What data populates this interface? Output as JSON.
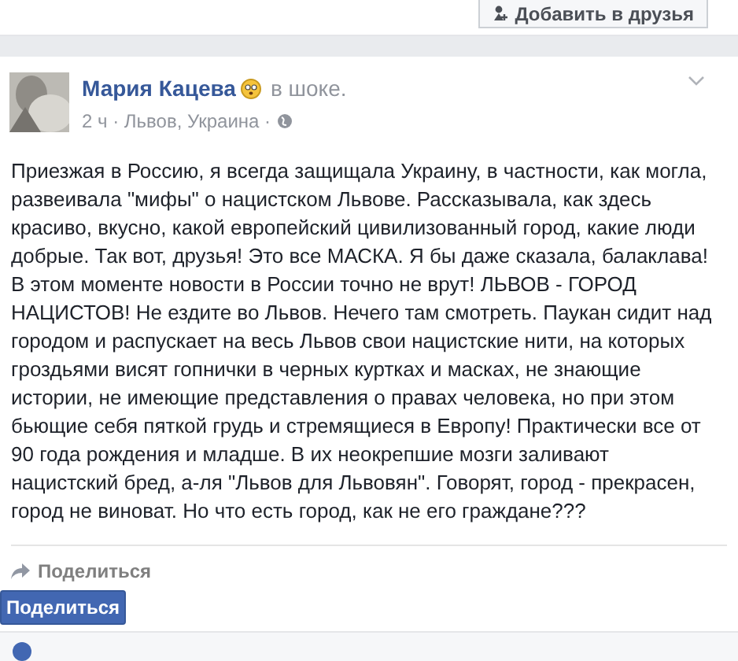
{
  "header": {
    "add_friend_button": "Добавить в друзья"
  },
  "post": {
    "author": "Мария Кацева",
    "feeling": "в шоке.",
    "meta": "2 ч · Львов, Украина ·",
    "body": "Приезжая в Россию, я всегда защищала Украину, в частности, как могла, развеивала \"мифы\" о нацистском Львове. Рассказывала, как здесь красиво, вкусно, какой европейский цивилизованный город, какие люди добрые. Так вот, друзья! Это все МАСКА. Я бы даже сказала, балаклава! В этом моменте новости в России точно не врут! ЛЬВОВ - ГОРОД НАЦИСТОВ! Не ездите во Львов. Нечего там смотреть. Паукан сидит над городом и распускает на весь Львов свои нацистские нити, на которых гроздьями висят гопнички в черных куртках и масках, не знающие истории, не имеющие представления о правах человека, но при этом бьющие себя пяткой грудь и стремящиеся в Европу! Практически все от 90 года рождения и младше. В их неокрепшие мозги заливают нацистский бред, а-ля \"Львов для Львовян\". Говорят, город - прекрасен, город не виноват. Но что есть город, как не его граждане???",
    "share_link": "Поделиться"
  },
  "share_button": "Поделиться"
}
